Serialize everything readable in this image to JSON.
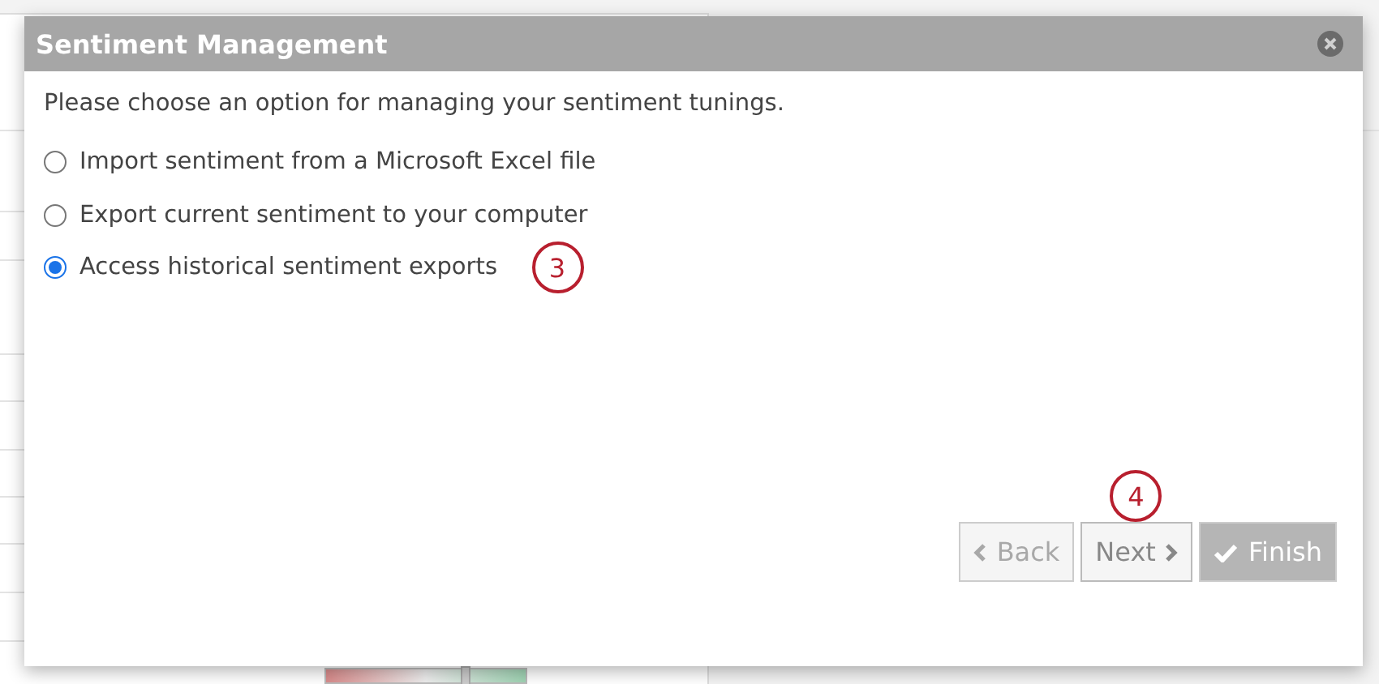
{
  "dialog": {
    "title": "Sentiment Management",
    "prompt": "Please choose an option for managing your sentiment tunings.",
    "options": [
      {
        "label": "Import sentiment from a Microsoft Excel file",
        "selected": false
      },
      {
        "label": "Export current sentiment to your computer",
        "selected": false
      },
      {
        "label": "Access historical sentiment exports",
        "selected": true,
        "annotation": "3"
      }
    ],
    "buttons": [
      {
        "kind": "back",
        "label": "Back",
        "disabled": true
      },
      {
        "kind": "next",
        "label": "Next",
        "disabled": false,
        "annotation": "4"
      },
      {
        "kind": "finish",
        "label": "Finish",
        "disabled": true
      }
    ]
  }
}
